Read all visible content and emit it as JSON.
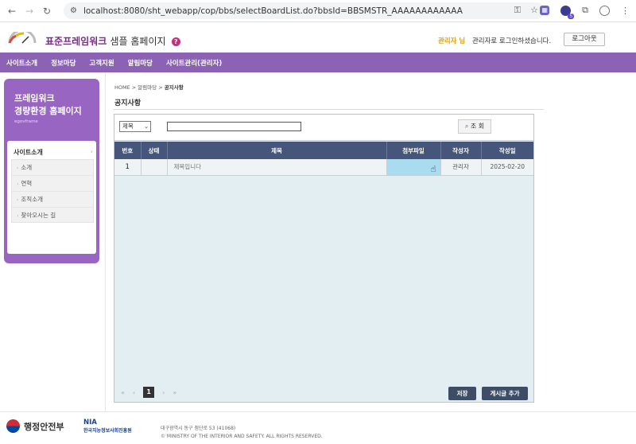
{
  "browser": {
    "url": "localhost:8080/sht_webapp/cop/bbs/selectBoardList.do?bbsId=BBSMSTR_AAAAAAAAAAAA",
    "ext_badge": "5"
  },
  "header": {
    "site_title": "표준프레임워크",
    "site_title_plain": "샘플 홈페이지",
    "help_glyph": "?",
    "user_name": "관리자 님",
    "user_msg": "관리자로 로그인하셨습니다.",
    "logout_label": "로그아웃"
  },
  "menu": [
    "사이트소개",
    "정보마당",
    "고객지원",
    "알림마당",
    "사이트관리(관리자)"
  ],
  "sidebar": {
    "title_line1": "프레임워크",
    "title_line2": "경량환경 홈페이지",
    "subtitle": "egovframe",
    "section": "사이트소개",
    "items": [
      "소개",
      "연혁",
      "조직소개",
      "찾아오시는 길"
    ]
  },
  "breadcrumb": {
    "path": "HOME > 알림마당 > ",
    "current": "공지사항"
  },
  "page_title": "공지사항",
  "search": {
    "select_value": "제목",
    "input_value": "",
    "button_label": "조 회"
  },
  "table": {
    "headers": [
      "번호",
      "상태",
      "제목",
      "첨부파일",
      "작성자",
      "작성일"
    ],
    "rows": [
      {
        "no": "1",
        "status": "",
        "title": "제목입니다",
        "attach": "",
        "writer": "관리자",
        "date": "2025-02-20"
      }
    ]
  },
  "pager": {
    "first": "«",
    "prev": "‹",
    "current": "1",
    "next": "›",
    "last": "»"
  },
  "buttons": {
    "save": "저장",
    "add_post": "게시글 추가"
  },
  "footer": {
    "ministry": "행정안전부",
    "nia": "NIA",
    "nia_kor": "한국지능정보사회진흥원",
    "address": "대구광역시 동구 첨단로 53 (41068)",
    "copyright": "© MINISTRY OF THE INTERIOR AND SAFETY. ALL RIGHTS RESERVED."
  },
  "colors": {
    "menu_bg": "#8b62b4",
    "sidebar_bg": "#9865c2",
    "table_header": "#45567a",
    "attach_highlight": "#a9dcee"
  }
}
